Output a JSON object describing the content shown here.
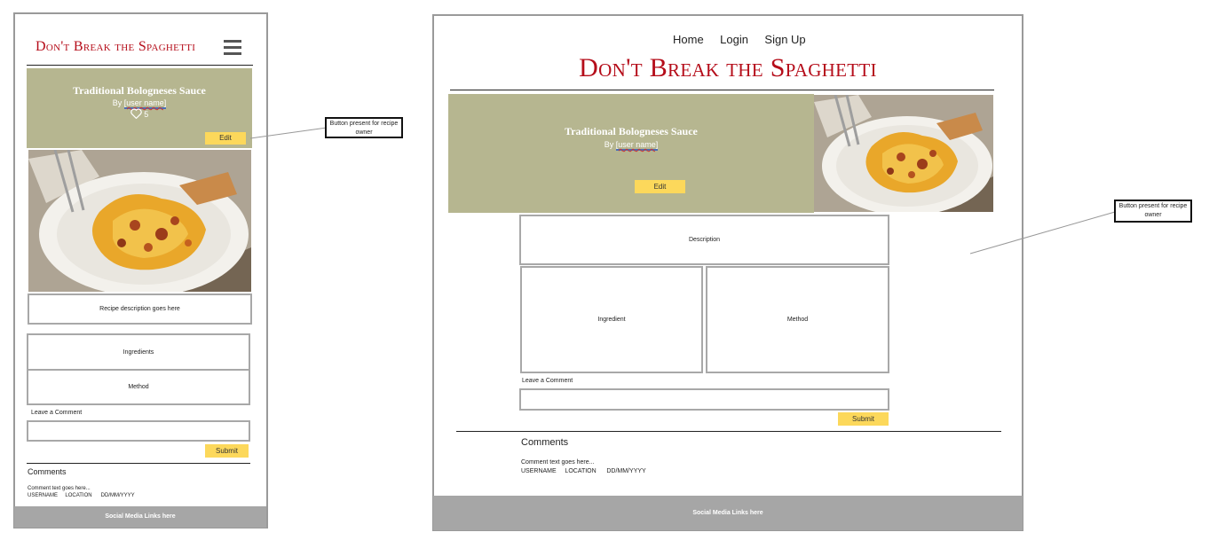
{
  "site_title": "Don't Break the Spaghetti",
  "recipe": {
    "title": "Traditional Bologneses Sauce",
    "by_label": "By",
    "user_name": "[user name]",
    "likes": "5"
  },
  "edit_label": "Edit",
  "annotation": "Button present for recipe owner",
  "nav": {
    "home": "Home",
    "login": "Login",
    "signup": "Sign Up"
  },
  "mobile": {
    "description": "Recipe description goes here",
    "ingredients": "Ingredients",
    "method": "Method"
  },
  "desktop": {
    "description": "Description",
    "ingredient": "Ingredient",
    "method": "Method"
  },
  "comment": {
    "leave_label": "Leave a Comment",
    "submit_label": "Submit",
    "heading": "Comments",
    "text": "Comment text goes here...",
    "username": "USERNAME",
    "location": "LOCATION",
    "date": "DD/MM/YYYY"
  },
  "footer_text": "Social Media Links here",
  "colors": {
    "title_red": "#b50d1a",
    "hero_bg": "#b6b690",
    "button": "#fcd85b",
    "footer": "#a6a6a6"
  }
}
